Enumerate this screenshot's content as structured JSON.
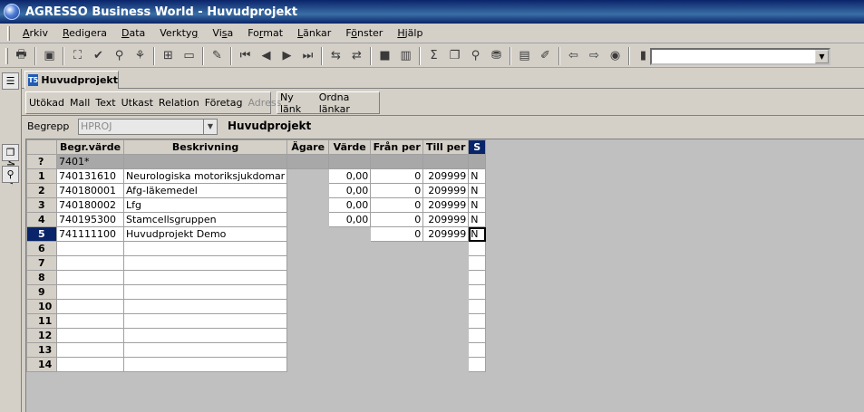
{
  "window": {
    "title": "AGRESSO Business World - Huvudprojekt"
  },
  "menu": [
    {
      "pre": "",
      "u": "A",
      "post": "rkiv"
    },
    {
      "pre": "",
      "u": "R",
      "post": "edigera"
    },
    {
      "pre": "",
      "u": "D",
      "post": "ata"
    },
    {
      "pre": "Verkty",
      "u": "g",
      "post": ""
    },
    {
      "pre": "Vi",
      "u": "s",
      "post": "a"
    },
    {
      "pre": "Fo",
      "u": "r",
      "post": "mat"
    },
    {
      "pre": "",
      "u": "L",
      "post": "änkar"
    },
    {
      "pre": "F",
      "u": "ö",
      "post": "nster"
    },
    {
      "pre": "",
      "u": "H",
      "post": "jälp"
    }
  ],
  "left_panel": {
    "label": "Meny"
  },
  "tab": {
    "icon": "T5",
    "label": "Huvudprojekt"
  },
  "subtoolbar": {
    "group1": [
      "Utökad",
      "Mall",
      "Text",
      "Utkast",
      "Relation",
      "Företag",
      "Adress"
    ],
    "group2": [
      "Ny länk",
      "Ordna länkar"
    ]
  },
  "begrepp": {
    "label": "Begrepp",
    "value": "HPROJ",
    "title": "Huvudprojekt"
  },
  "grid": {
    "columns": [
      "Begr.värde",
      "Beskrivning",
      "Ägare",
      "Värde",
      "Från per",
      "Till per",
      "S"
    ],
    "filter_row": {
      "marker": "?",
      "value": "7401*"
    },
    "rows": [
      {
        "n": "1",
        "begr": "740131610",
        "beskr": "Neurologiska motoriksjukdomar",
        "agare": "",
        "varde": "0,00",
        "fran": "0",
        "till": "209999",
        "s": "N"
      },
      {
        "n": "2",
        "begr": "740180001",
        "beskr": "Afg-läkemedel",
        "agare": "",
        "varde": "0,00",
        "fran": "0",
        "till": "209999",
        "s": "N"
      },
      {
        "n": "3",
        "begr": "740180002",
        "beskr": "Lfg",
        "agare": "",
        "varde": "0,00",
        "fran": "0",
        "till": "209999",
        "s": "N"
      },
      {
        "n": "4",
        "begr": "740195300",
        "beskr": "Stamcellsgruppen",
        "agare": "",
        "varde": "0,00",
        "fran": "0",
        "till": "209999",
        "s": "N"
      },
      {
        "n": "5",
        "begr": "741111100",
        "beskr": "Huvudprojekt Demo",
        "agare": "",
        "varde": "",
        "fran": "0",
        "till": "209999",
        "s": "N"
      }
    ],
    "empty_rows": [
      "6",
      "7",
      "8",
      "9",
      "10",
      "11",
      "12",
      "13",
      "14"
    ]
  }
}
